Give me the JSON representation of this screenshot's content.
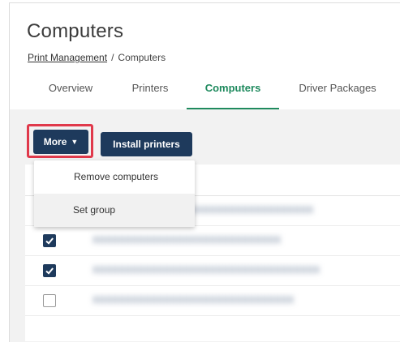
{
  "header": {
    "title": "Computers",
    "breadcrumb": {
      "link": "Print Management",
      "separator": "/",
      "current": "Computers"
    }
  },
  "tabs": [
    {
      "label": "Overview",
      "active": false
    },
    {
      "label": "Printers",
      "active": false
    },
    {
      "label": "Computers",
      "active": true
    },
    {
      "label": "Driver Packages",
      "active": false
    }
  ],
  "toolbar": {
    "more_label": "More",
    "install_label": "Install printers"
  },
  "dropdown": {
    "items": [
      "Remove computers",
      "Set group"
    ]
  },
  "rows": [
    {
      "checked": false,
      "name": "XXXXXXXXXXXXXXXXXXXXXXXXXXXXXXXXXX"
    },
    {
      "checked": true,
      "name": "XXXXXXXXXXXXXXXXXXXXXXXXXXXXX"
    },
    {
      "checked": true,
      "name": "XXXXXXXXXXXXXXXXXXXXXXXXXXXXXXXXXXX"
    },
    {
      "checked": false,
      "name": "XXXXXXXXXXXXXXXXXXXXXXXXXXXXXXX"
    }
  ],
  "colors": {
    "accent": "#1f8a5e",
    "primary_button": "#1e3a5c",
    "highlight": "#e0394b"
  }
}
